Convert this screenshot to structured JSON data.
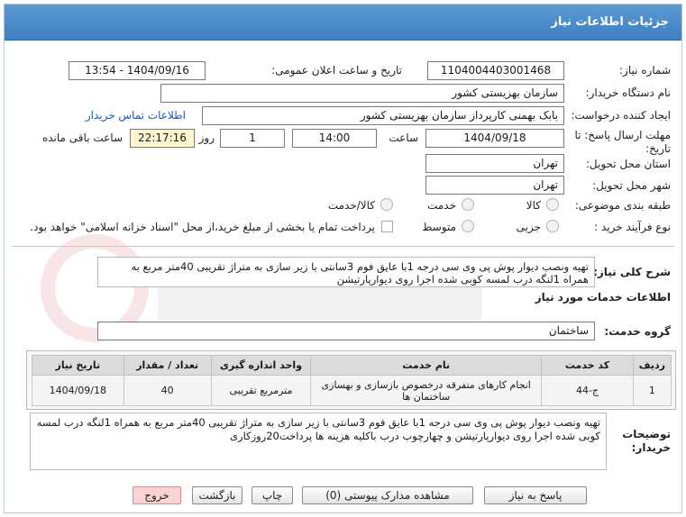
{
  "header": {
    "title": "جزئیات اطلاعات نیاز"
  },
  "fields": {
    "need_number_label": "شماره نیاز:",
    "need_number": "1104004403001468",
    "announce_label": "تاریخ و ساعت اعلان عمومی:",
    "announce_value": "1404/09/16 - 13:54",
    "buyer_org_label": "نام دستگاه خریدار:",
    "buyer_org": "سازمان بهزیستی کشور",
    "creator_label": "ایجاد کننده درخواست:",
    "creator": "بابک بهمنی کارپرداز سازمان بهزیستی کشور",
    "contact_link": "اطلاعات تماس خریدار",
    "deadline_label": "مهلت ارسال پاسخ: تا تاریخ:",
    "deadline_date": "1404/09/18",
    "time_label": "ساعت",
    "deadline_time": "14:00",
    "days_value": "1",
    "days_label": "روز و",
    "remaining_time": "22:17:16",
    "remaining_label": "ساعت باقی مانده",
    "province_label": "استان محل تحویل:",
    "province": "تهران",
    "city_label": "شهر محل تحویل:",
    "city": "تهران",
    "category_label": "طبقه بندی موضوعی:",
    "category_options": [
      "کالا",
      "خدمت",
      "کالا/خدمت"
    ],
    "process_label": "نوع فرآیند خرید :",
    "process_options": [
      "جزیی",
      "متوسط"
    ],
    "payment_note": "پرداخت تمام یا بخشی از مبلغ خرید،از محل \"اسناد خزانه اسلامی\" خواهد بود."
  },
  "description": {
    "label": "شرح کلی نیاز:",
    "text": "تهیه ونصب دیوار پوش پی وی سی درجه 1با عایق فوم 3سانتی با زیر سازی به متراژ تقریبی 40متر مربع به همراه 1لنگه درب لمسه کوبی شده اجرا روی دیوارپارتیشن"
  },
  "services": {
    "section_title": "اطلاعات خدمات مورد نیاز",
    "group_label": "گروه خدمت:",
    "group_value": "ساختمان",
    "columns": [
      "ردیف",
      "کد خدمت",
      "نام خدمت",
      "واحد اندازه گیری",
      "تعداد / مقدار",
      "تاریخ نیاز"
    ],
    "rows": [
      [
        "1",
        "ج-44",
        "انجام کارهای متفرقه درخصوص بازسازی و بهسازی ساختمان ها",
        "مترمربع تقریبی",
        "40",
        "1404/09/18"
      ]
    ]
  },
  "buyer_notes": {
    "label": "توضیحات خریدار:",
    "text": "تهیه ونصب دیوار پوش پی وی سی درجه 1با عایق فوم 3سانتی با زیر سازی به متراژ تقریبی 40متر مربع به همراه 1لنگه درب لمسه کوبی شده اجرا روی دیوارپارتیشن و چهارچوب درب باکلیه هزینه ها پرداخت20روزکاری"
  },
  "buttons": {
    "respond": "پاسخ به نیاز",
    "view_docs": "مشاهده مدارک پیوستی (0)",
    "print": "چاپ",
    "back": "بازگشت",
    "exit": "خروج"
  },
  "colors": {
    "titlebar": "#4a8ccc",
    "accent_link": "#1a56c4",
    "timer_bg": "#fdf6cf"
  }
}
